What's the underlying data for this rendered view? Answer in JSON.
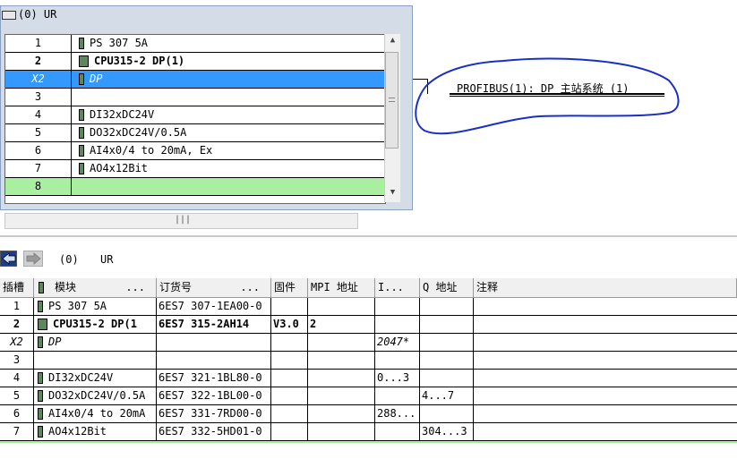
{
  "rack": {
    "title": "(0)  UR",
    "rows": [
      {
        "slot": "1",
        "module": "PS 307 5A",
        "style": ""
      },
      {
        "slot": "2",
        "module": "CPU315-2 DP(1)",
        "style": "bold",
        "icon": "cpu"
      },
      {
        "slot": "X2",
        "module": "DP",
        "style": "selected"
      },
      {
        "slot": "3",
        "module": "",
        "style": ""
      },
      {
        "slot": "4",
        "module": "DI32xDC24V",
        "style": ""
      },
      {
        "slot": "5",
        "module": "DO32xDC24V/0.5A",
        "style": ""
      },
      {
        "slot": "6",
        "module": "AI4x0/4 to 20mA, Ex",
        "style": ""
      },
      {
        "slot": "7",
        "module": "AO4x12Bit",
        "style": ""
      },
      {
        "slot": "8",
        "module": "",
        "style": "green"
      }
    ]
  },
  "profibus": {
    "label": "PROFIBUS(1): DP 主站系统 (1)",
    "highlight_color": "#1a2fc8"
  },
  "nav": {
    "label_0": "(0)",
    "label_ur": "UR"
  },
  "detail": {
    "columns": [
      "插槽",
      "模块",
      "订货号",
      "固件",
      "MPI 地址",
      "I...",
      "Q 地址",
      "注释"
    ],
    "module_col_suffix": "...",
    "order_col_suffix": "...",
    "rows": [
      {
        "slot": "1",
        "module": "PS 307 5A",
        "order": "6ES7 307-1EA00-0",
        "fw": "",
        "mpi": "",
        "i": "",
        "q": "",
        "style": ""
      },
      {
        "slot": "2",
        "module": "CPU315-2 DP(1",
        "order": "6ES7 315-2AH14",
        "fw": "V3.0",
        "mpi": "2",
        "i": "",
        "q": "",
        "style": "bold",
        "icon": "cpu"
      },
      {
        "slot": "X2",
        "module": "DP",
        "order": "",
        "fw": "",
        "mpi": "",
        "i": "2047*",
        "q": "",
        "style": "italic"
      },
      {
        "slot": "3",
        "module": "",
        "order": "",
        "fw": "",
        "mpi": "",
        "i": "",
        "q": "",
        "style": "",
        "noicon": true
      },
      {
        "slot": "4",
        "module": "DI32xDC24V",
        "order": "6ES7 321-1BL80-0",
        "fw": "",
        "mpi": "",
        "i": "0...3",
        "q": "",
        "style": ""
      },
      {
        "slot": "5",
        "module": "DO32xDC24V/0.5A",
        "order": "6ES7 322-1BL00-0",
        "fw": "",
        "mpi": "",
        "i": "",
        "q": "4...7",
        "style": ""
      },
      {
        "slot": "6",
        "module": "AI4x0/4 to 20mA",
        "order": "6ES7 331-7RD00-0",
        "fw": "",
        "mpi": "",
        "i": "288...",
        "q": "",
        "style": ""
      },
      {
        "slot": "7",
        "module": "AO4x12Bit",
        "order": "6ES7 332-5HD01-0",
        "fw": "",
        "mpi": "",
        "i": "",
        "q": "304...3",
        "style": ""
      }
    ]
  }
}
